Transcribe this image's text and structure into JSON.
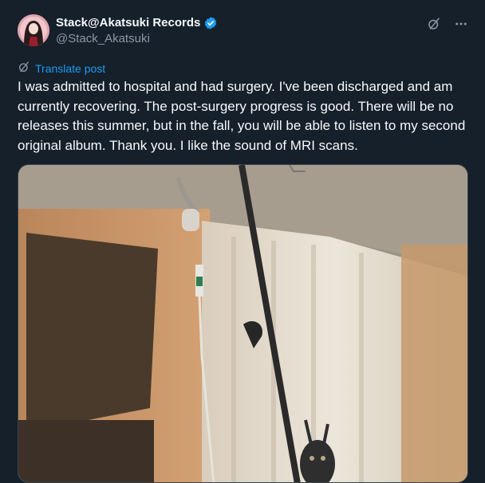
{
  "author": {
    "display_name": "Stack@Akatsuki Records",
    "handle": "@Stack_Akatsuki",
    "verified_icon": "verified-badge-icon",
    "avatar_icon": "avatar-image"
  },
  "actions": {
    "grok_icon": "grok-icon",
    "more_icon": "more-icon"
  },
  "translate": {
    "label": "Translate post",
    "icon": "translate-icon"
  },
  "post": {
    "text": "I was admitted to hospital and had surgery. I've been discharged and am currently recovering. The post-surgery progress is good. There will be no releases this summer, but in the fall, you will be able to listen to my second original album. Thank you. I like the sound of MRI scans."
  },
  "colors": {
    "background": "#15202b",
    "text": "#f7f9f9",
    "secondary": "#8b98a5",
    "accent": "#1d9bf0"
  }
}
